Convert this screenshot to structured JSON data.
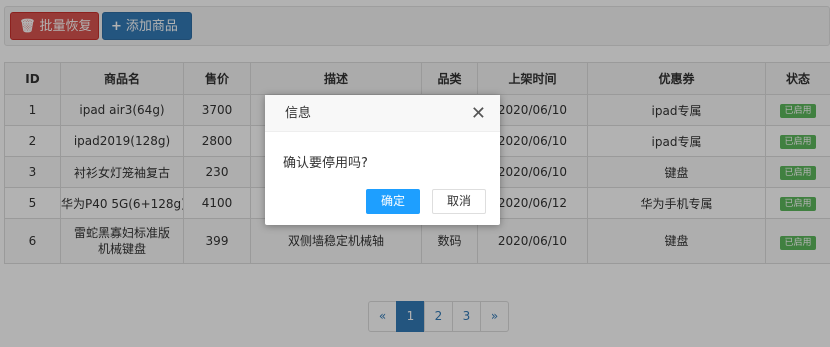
{
  "toolbar": {
    "batch_restore": "批量恢复",
    "add_product": "添加商品"
  },
  "table": {
    "headers": [
      "ID",
      "商品名",
      "售价",
      "描述",
      "品类",
      "上架时间",
      "优惠券",
      "状态"
    ],
    "rows": [
      {
        "id": "1",
        "name": "ipad air3(64g)",
        "price": "3700",
        "desc": "",
        "category": "",
        "date": "2020/06/10",
        "coupon": "ipad专属",
        "status": "已启用"
      },
      {
        "id": "2",
        "name": "ipad2019(128g)",
        "price": "2800",
        "desc": "",
        "category": "",
        "date": "2020/06/10",
        "coupon": "ipad专属",
        "status": "已启用"
      },
      {
        "id": "3",
        "name": "衬衫女灯笼袖复古",
        "price": "230",
        "desc": "",
        "category": "",
        "date": "2020/06/10",
        "coupon": "键盘",
        "status": "已启用"
      },
      {
        "id": "5",
        "name": "华为P40 5G(6+128g)",
        "price": "4100",
        "desc": "",
        "category": "",
        "date": "2020/06/12",
        "coupon": "华为手机专属",
        "status": "已启用"
      },
      {
        "id": "6",
        "name": "雷蛇黑寡妇标准版机械键盘",
        "price": "399",
        "desc": "双侧墙稳定机械轴",
        "category": "数码",
        "date": "2020/06/10",
        "coupon": "键盘",
        "status": "已启用"
      }
    ]
  },
  "pagination": {
    "prev": "«",
    "pages": [
      "1",
      "2",
      "3"
    ],
    "active": "1",
    "next": "»"
  },
  "dialog": {
    "title": "信息",
    "close": "✕",
    "message": "确认要停用吗?",
    "ok": "确定",
    "cancel": "取消"
  },
  "colors": {
    "danger": "#d9534f",
    "primary": "#337ab7",
    "success": "#5cb85c",
    "dialog_ok": "#1e9fff"
  },
  "icons": {
    "batch_restore": "trash-icon",
    "add_product": "plus-icon"
  }
}
